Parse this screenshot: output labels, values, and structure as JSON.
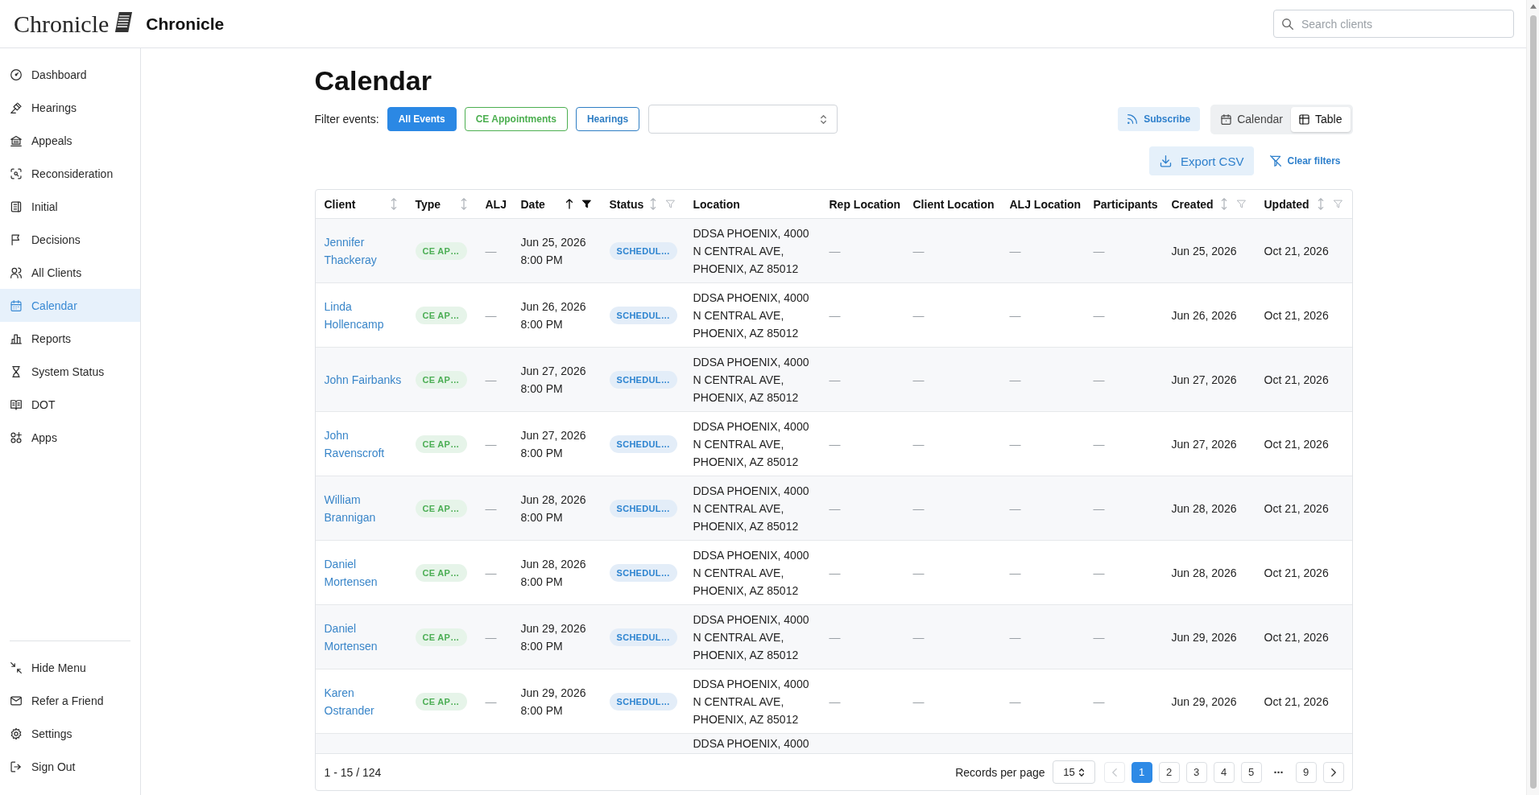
{
  "header": {
    "logo_text": "Chronicle",
    "app_name": "Chronicle",
    "search": {
      "placeholder": "Search clients"
    }
  },
  "sidebar": {
    "items": [
      {
        "label": "Dashboard",
        "selected": false
      },
      {
        "label": "Hearings",
        "selected": false
      },
      {
        "label": "Appeals",
        "selected": false
      },
      {
        "label": "Reconsideration",
        "selected": false
      },
      {
        "label": "Initial",
        "selected": false
      },
      {
        "label": "Decisions",
        "selected": false
      },
      {
        "label": "All Clients",
        "selected": false
      },
      {
        "label": "Calendar",
        "selected": true
      },
      {
        "label": "Reports",
        "selected": false
      },
      {
        "label": "System Status",
        "selected": false
      },
      {
        "label": "DOT",
        "selected": false
      },
      {
        "label": "Apps",
        "selected": false
      }
    ],
    "footer_items": [
      {
        "label": "Hide Menu"
      },
      {
        "label": "Refer a Friend"
      },
      {
        "label": "Settings"
      },
      {
        "label": "Sign Out"
      }
    ]
  },
  "page": {
    "title": "Calendar",
    "filter_label": "Filter events:",
    "filters": [
      {
        "label": "All Events",
        "selected": true,
        "color": "#2b88e4"
      },
      {
        "label": "CE Appointments",
        "selected": false,
        "color": "#4caf50"
      },
      {
        "label": "Hearings",
        "selected": false,
        "color": "#2f7ec4"
      }
    ],
    "subscribe_button": "Subscribe",
    "view_toggle": [
      {
        "label": "Calendar",
        "selected": false
      },
      {
        "label": "Table",
        "selected": true
      }
    ],
    "export_button": "Export CSV",
    "clear_filters_link": "Clear filters"
  },
  "table": {
    "columns": [
      {
        "label": "Client",
        "sorted": false
      },
      {
        "label": "Type",
        "sorted": false
      },
      {
        "label": "ALJ"
      },
      {
        "label": "Date",
        "sorted": true,
        "filtered": true
      },
      {
        "label": "Status",
        "sorted": false,
        "filtered": false
      },
      {
        "label": "Location"
      },
      {
        "label": "Rep Location"
      },
      {
        "label": "Client Location"
      },
      {
        "label": "ALJ Location"
      },
      {
        "label": "Participants"
      },
      {
        "label": "Created",
        "sorted": false,
        "filtered": false
      },
      {
        "label": "Updated",
        "sorted": false,
        "filtered": false
      }
    ],
    "rows": [
      {
        "client": "Jennifer Thackeray",
        "type": "CE AP…",
        "alj": "—",
        "date": "Jun 25, 2026",
        "time": "8:00 PM",
        "status": "SCHEDUL…",
        "location": "DDSA PHOENIX, 4000 N CENTRAL AVE, PHOENIX, AZ 85012",
        "rep_location": "—",
        "client_location": "—",
        "alj_location": "—",
        "participants": "—",
        "created": "Jun 25, 2026",
        "updated": "Oct 21, 2026"
      },
      {
        "client": "Linda Hollencamp",
        "type": "CE AP…",
        "alj": "—",
        "date": "Jun 26, 2026",
        "time": "8:00 PM",
        "status": "SCHEDUL…",
        "location": "DDSA PHOENIX, 4000 N CENTRAL AVE, PHOENIX, AZ 85012",
        "rep_location": "—",
        "client_location": "—",
        "alj_location": "—",
        "participants": "—",
        "created": "Jun 26, 2026",
        "updated": "Oct 21, 2026"
      },
      {
        "client": "John Fairbanks",
        "type": "CE AP…",
        "alj": "—",
        "date": "Jun 27, 2026",
        "time": "8:00 PM",
        "status": "SCHEDUL…",
        "location": "DDSA PHOENIX, 4000 N CENTRAL AVE, PHOENIX, AZ 85012",
        "rep_location": "—",
        "client_location": "—",
        "alj_location": "—",
        "participants": "—",
        "created": "Jun 27, 2026",
        "updated": "Oct 21, 2026"
      },
      {
        "client": "John Ravenscroft",
        "type": "CE AP…",
        "alj": "—",
        "date": "Jun 27, 2026",
        "time": "8:00 PM",
        "status": "SCHEDUL…",
        "location": "DDSA PHOENIX, 4000 N CENTRAL AVE, PHOENIX, AZ 85012",
        "rep_location": "—",
        "client_location": "—",
        "alj_location": "—",
        "participants": "—",
        "created": "Jun 27, 2026",
        "updated": "Oct 21, 2026"
      },
      {
        "client": "William Brannigan",
        "type": "CE AP…",
        "alj": "—",
        "date": "Jun 28, 2026",
        "time": "8:00 PM",
        "status": "SCHEDUL…",
        "location": "DDSA PHOENIX, 4000 N CENTRAL AVE, PHOENIX, AZ 85012",
        "rep_location": "—",
        "client_location": "—",
        "alj_location": "—",
        "participants": "—",
        "created": "Jun 28, 2026",
        "updated": "Oct 21, 2026"
      },
      {
        "client": "Daniel Mortensen",
        "type": "CE AP…",
        "alj": "—",
        "date": "Jun 28, 2026",
        "time": "8:00 PM",
        "status": "SCHEDUL…",
        "location": "DDSA PHOENIX, 4000 N CENTRAL AVE, PHOENIX, AZ 85012",
        "rep_location": "—",
        "client_location": "—",
        "alj_location": "—",
        "participants": "—",
        "created": "Jun 28, 2026",
        "updated": "Oct 21, 2026"
      },
      {
        "client": "Daniel Mortensen",
        "type": "CE AP…",
        "alj": "—",
        "date": "Jun 29, 2026",
        "time": "8:00 PM",
        "status": "SCHEDUL…",
        "location": "DDSA PHOENIX, 4000 N CENTRAL AVE, PHOENIX, AZ 85012",
        "rep_location": "—",
        "client_location": "—",
        "alj_location": "—",
        "participants": "—",
        "created": "Jun 29, 2026",
        "updated": "Oct 21, 2026"
      },
      {
        "client": "Karen Ostrander",
        "type": "CE AP…",
        "alj": "—",
        "date": "Jun 29, 2026",
        "time": "8:00 PM",
        "status": "SCHEDUL…",
        "location": "DDSA PHOENIX, 4000 N CENTRAL AVE, PHOENIX, AZ 85012",
        "rep_location": "—",
        "client_location": "—",
        "alj_location": "—",
        "participants": "—",
        "created": "Jun 29, 2026",
        "updated": "Oct 21, 2026"
      }
    ],
    "partial_row": {
      "location": "DDSA PHOENIX, 4000"
    },
    "footer": {
      "range": "1 - 15 / 124",
      "per_page_label": "Records per page",
      "per_page_value": "15",
      "pagination": {
        "previous": {
          "disabled": true
        },
        "pages": [
          {
            "label": "1",
            "kind": "page",
            "selected": true
          },
          {
            "label": "2",
            "kind": "page",
            "selected": false
          },
          {
            "label": "3",
            "kind": "page",
            "selected": false
          },
          {
            "label": "4",
            "kind": "page",
            "selected": false
          },
          {
            "label": "5",
            "kind": "page",
            "selected": false
          },
          {
            "label": "⋯",
            "kind": "gap"
          },
          {
            "label": "9",
            "kind": "page",
            "selected": false
          }
        ],
        "next": {
          "disabled": false
        }
      }
    }
  }
}
